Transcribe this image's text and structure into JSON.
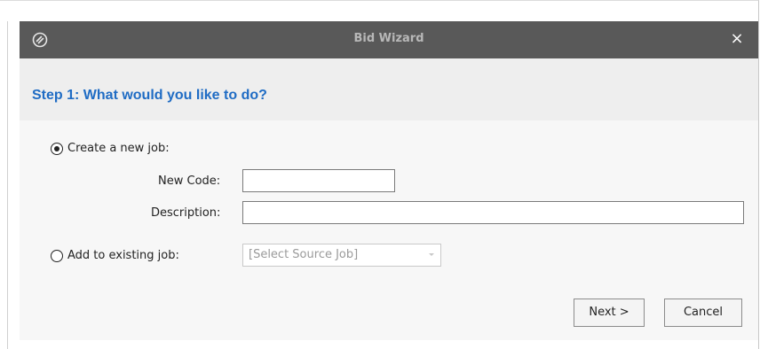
{
  "window": {
    "title": "Bid Wizard",
    "close_label": "×",
    "logo_icon": "app-logo-icon",
    "titlebar_color": "#595959"
  },
  "header": {
    "step_title": "Step 1: What would you like to do?",
    "step_color": "#1f6cc4"
  },
  "form": {
    "create_option": {
      "label": "Create a new job:",
      "selected": true
    },
    "new_code": {
      "label": "New Code:",
      "value": "",
      "placeholder": ""
    },
    "description": {
      "label": "Description:",
      "value": "",
      "placeholder": ""
    },
    "existing_option": {
      "label": "Add to existing job:",
      "selected": false
    },
    "source_job": {
      "selected_value": "[Select Source Job]",
      "enabled": false
    }
  },
  "buttons": {
    "next_label": "Next >",
    "cancel_label": "Cancel"
  }
}
